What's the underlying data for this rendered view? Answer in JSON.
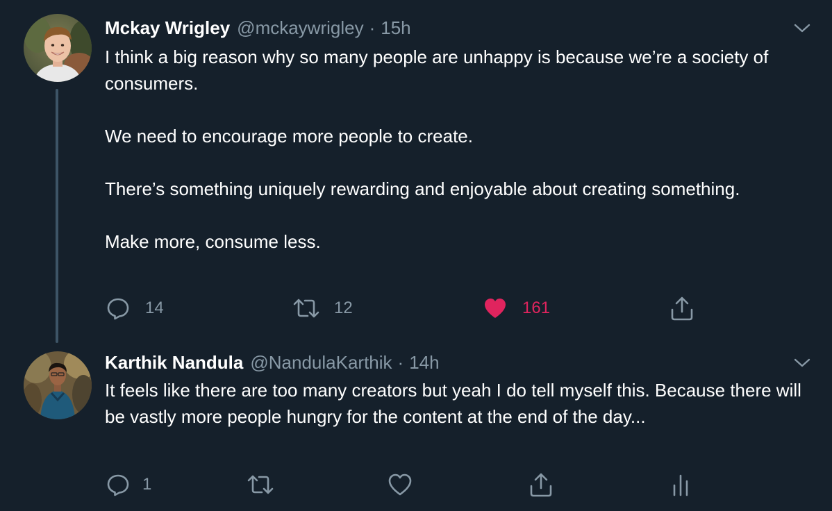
{
  "tweets": [
    {
      "author": {
        "name": "Mckay Wrigley",
        "handle": "@mckaywrigley"
      },
      "separator": "·",
      "time": "15h",
      "paragraphs": [
        "I think a big reason why so many people are unhappy is because we’re a society of consumers.",
        "We need to encourage more people to create.",
        "There’s something uniquely rewarding and enjoyable about creating something.",
        "Make more, consume less."
      ],
      "actions": {
        "reply_count": "14",
        "retweet_count": "12",
        "like_count": "161",
        "liked": true
      }
    },
    {
      "author": {
        "name": "Karthik Nandula",
        "handle": "@NandulaKarthik"
      },
      "separator": "·",
      "time": "14h",
      "paragraphs": [
        "It feels like there are too many creators but yeah I do tell myself this. Because there will be vastly more people hungry for the content at the end of the day..."
      ],
      "actions": {
        "reply_count": "1",
        "retweet_count": "",
        "like_count": "",
        "liked": false
      }
    }
  ],
  "icons": {
    "reply": "reply-icon",
    "retweet": "retweet-icon",
    "like": "heart-icon",
    "share": "share-icon",
    "analytics": "analytics-icon",
    "more": "chevron-down-icon"
  },
  "colors": {
    "background": "#15202b",
    "secondary_text": "#8899a6",
    "like_active": "#e0245e",
    "thread_line": "#3d5466"
  }
}
